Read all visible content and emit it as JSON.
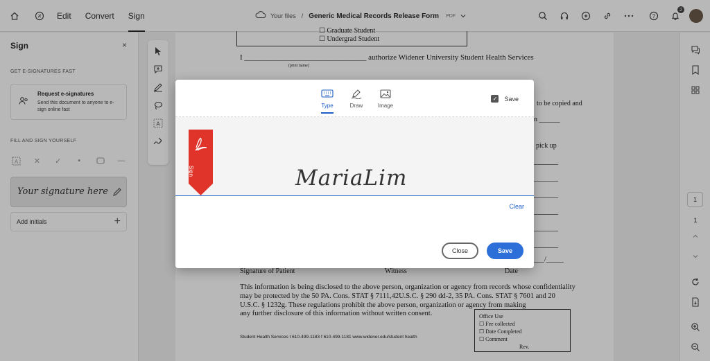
{
  "topbar": {
    "menus": [
      "Edit",
      "Convert",
      "Sign"
    ],
    "active_menu": "Sign",
    "breadcrumb_root": "Your files",
    "breadcrumb_sep": "/",
    "doc_title": "Generic Medical Records Release Form",
    "doc_ext": "PDF",
    "notification_count": "2"
  },
  "left_panel": {
    "title": "Sign",
    "close": "×",
    "section_esign": "GET E-SIGNATURES FAST",
    "request_title": "Request e-signatures",
    "request_desc": "Send this document to anyone to e-sign online fast",
    "section_fill": "FILL AND SIGN YOURSELF",
    "signature_placeholder": "Your signature here",
    "add_initials": "Add initials",
    "plus": "+"
  },
  "document": {
    "checkbox_lines": [
      "☐ Graduate Student",
      "☐ Undergrad Student"
    ],
    "authorize_line": "I ________________________________ authorize Widener University Student Health Services",
    "print_name": "(print name)",
    "right_fragments": [
      "to be copied and",
      "n ______",
      "pick up"
    ],
    "sig_labels": [
      "Signature of Patient",
      "Witness",
      "Date"
    ],
    "date_blank": "___/_____",
    "paragraph": [
      "This information is being disclosed to the above person, organization or agency from records whose confidentiality",
      "may be protected by the 50 PA. Cons. STAT § 7111,42U.S.C. § 290 dd-2, 35 PA. Cons. STAT § 7601 and 20",
      "U.S.C. § 1232g.  These regulations prohibit the above person, organization or agency from making",
      "any further disclosure of this information without written consent."
    ],
    "footer": "Student Health Services   t  610-499-1183     f  610-499-1181     www.widener.edu/student health",
    "office": {
      "title": "Office Use",
      "items": [
        "☐ Fee collected",
        "☐ Date Completed",
        "☐ Comment"
      ],
      "rev": "Rev."
    }
  },
  "right_rail": {
    "page_box": "1",
    "page_num": "1"
  },
  "modal": {
    "tabs": [
      "Type",
      "Draw",
      "Image"
    ],
    "active_tab": "Type",
    "save_label": "Save",
    "save_checked": true,
    "sign_flag_label": "Sign",
    "signature": "MariaLim",
    "clear": "Clear",
    "close_btn": "Close",
    "save_btn": "Save"
  },
  "colors": {
    "accent": "#2d6fd8",
    "flag_red": "#e0342a"
  }
}
